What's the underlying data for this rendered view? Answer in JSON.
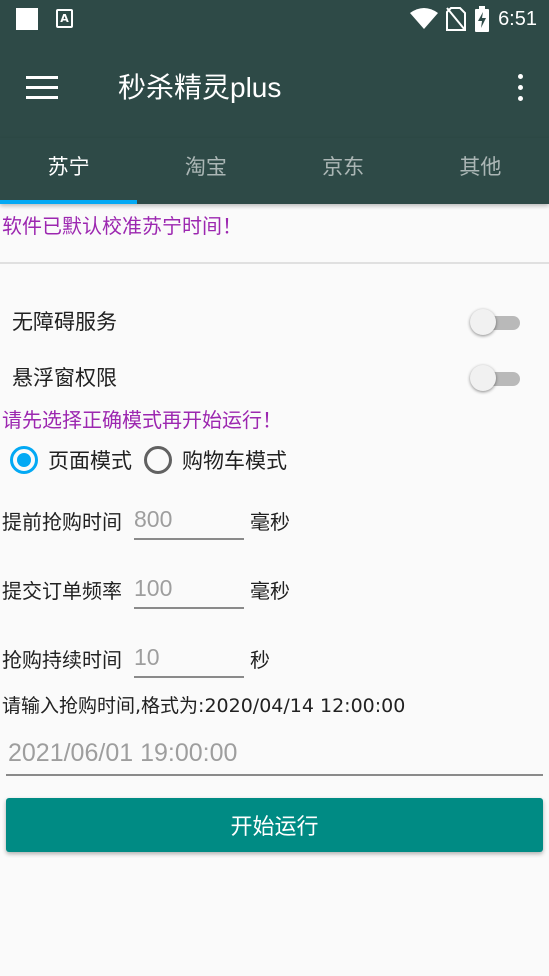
{
  "status_bar": {
    "time": "6:51",
    "icons": [
      "notification-square-icon",
      "a-font-icon",
      "wifi-icon",
      "no-sim-icon",
      "battery-charging-icon"
    ]
  },
  "app_bar": {
    "title": "秒杀精灵plus",
    "icons": [
      "menu-icon",
      "more-vert-icon"
    ]
  },
  "tabs": [
    {
      "label": "苏宁",
      "active": true
    },
    {
      "label": "淘宝",
      "active": false
    },
    {
      "label": "京东",
      "active": false
    },
    {
      "label": "其他",
      "active": false
    }
  ],
  "notices": {
    "calibrated": "软件已默认校准苏宁时间！",
    "choose_mode": "请先选择正确模式再开始运行！"
  },
  "switches": [
    {
      "label": "无障碍服务",
      "on": false
    },
    {
      "label": "悬浮窗权限",
      "on": false
    }
  ],
  "modes": [
    {
      "label": "页面模式",
      "checked": true
    },
    {
      "label": "购物车模式",
      "checked": false
    }
  ],
  "fields": [
    {
      "label": "提前抢购时间",
      "placeholder": "800",
      "unit": "毫秒"
    },
    {
      "label": "提交订单频率",
      "placeholder": "100",
      "unit": "毫秒"
    },
    {
      "label": "抢购持续时间",
      "placeholder": "10",
      "unit": "秒"
    }
  ],
  "time_entry": {
    "hint": "请输入抢购时间,格式为:2020/04/14 12:00:00",
    "placeholder": "2021/06/01 19:00:00"
  },
  "start_button": {
    "label": "开始运行"
  },
  "colors": {
    "toolbar": "#2e4a47",
    "tab_indicator": "#03a9f4",
    "notice_text": "#9c27b0",
    "radio_checked": "#03a9f4",
    "button": "#008b84"
  }
}
